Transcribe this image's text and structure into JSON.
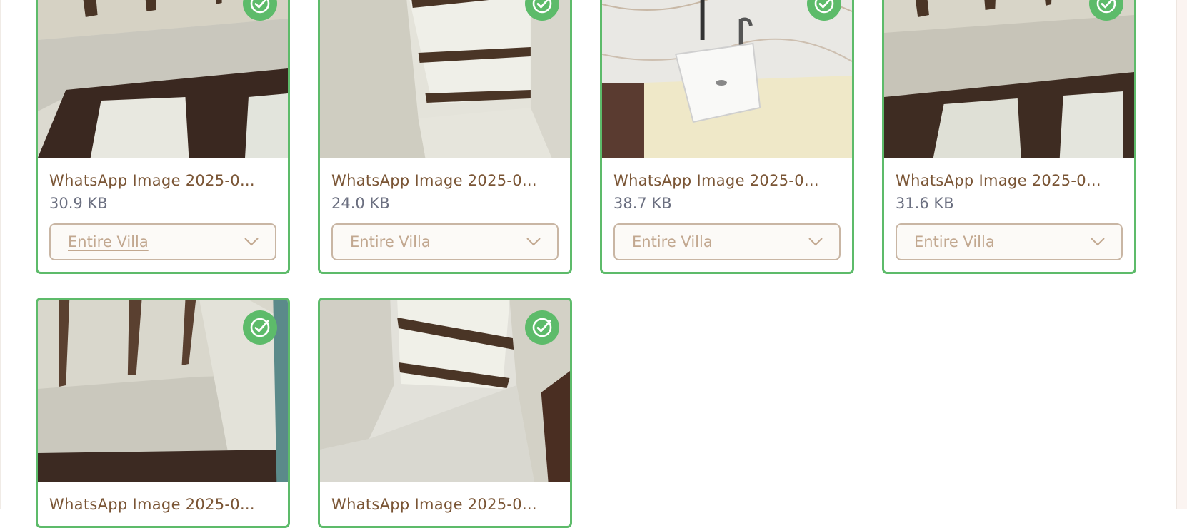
{
  "cards": [
    {
      "name": "WhatsApp Image 2025-0...",
      "size": "30.9 KB",
      "category": "Entire Villa",
      "selected": true,
      "image": "ceiling-window-photo"
    },
    {
      "name": "WhatsApp Image 2025-0...",
      "size": "24.0 KB",
      "category": "Entire Villa",
      "selected": true,
      "image": "ceiling-beams-photo"
    },
    {
      "name": "WhatsApp Image 2025-0...",
      "size": "38.7 KB",
      "category": "Entire Villa",
      "selected": true,
      "image": "bathroom-sink-photo"
    },
    {
      "name": "WhatsApp Image 2025-0...",
      "size": "31.6 KB",
      "category": "Entire Villa",
      "selected": true,
      "image": "ceiling-window-photo"
    },
    {
      "name": "WhatsApp Image 2025-0...",
      "selected": true,
      "image": "ceiling-window-photo"
    },
    {
      "name": "WhatsApp Image 2025-0...",
      "selected": true,
      "image": "ceiling-beams-photo"
    }
  ],
  "colors": {
    "selected_border": "#5dbb6a",
    "file_name": "#7a5535",
    "file_size": "#6b6f80",
    "select_border": "#c9b6a4",
    "select_text": "#c2a890"
  }
}
